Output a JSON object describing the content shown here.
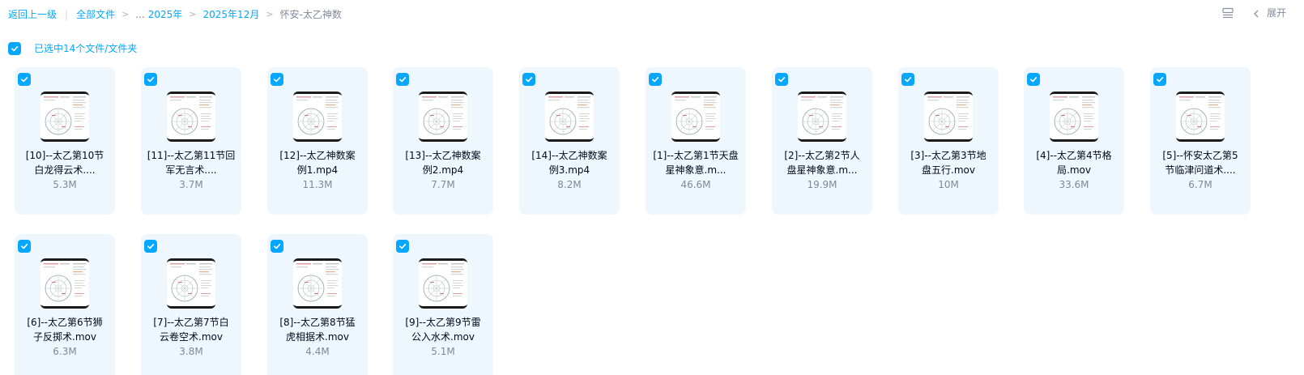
{
  "breadcrumb": {
    "back": "返回上一级",
    "all_files": "全部文件",
    "ellipsis": "...",
    "year": "2025年",
    "month": "2025年12月",
    "current": "怀安-太乙神数",
    "separator": "|",
    "arrow": ">"
  },
  "toolbar": {
    "list_view_icon": "list-view-icon",
    "collapse_icon": "chevron-left-icon",
    "expand_label": "展开"
  },
  "selection": {
    "label": "已选中14个文件/文件夹",
    "checked": true
  },
  "colors": {
    "accent": "#06a7ff",
    "card_bg": "#eef7fe",
    "text_primary": "#03081a",
    "text_secondary": "#818999"
  },
  "files": [
    {
      "line1": "[10]--太乙第10节",
      "line2": "白龙得云术....",
      "size": "5.3M",
      "checked": true
    },
    {
      "line1": "[11]--太乙第11节回",
      "line2": "军无言术....",
      "size": "3.7M",
      "checked": true
    },
    {
      "line1": "[12]--太乙神数案",
      "line2": "例1.mp4",
      "size": "11.3M",
      "checked": true
    },
    {
      "line1": "[13]--太乙神数案",
      "line2": "例2.mp4",
      "size": "7.7M",
      "checked": true
    },
    {
      "line1": "[14]--太乙神数案",
      "line2": "例3.mp4",
      "size": "8.2M",
      "checked": true
    },
    {
      "line1": "[1]--太乙第1节天盘",
      "line2": "星神象意.m...",
      "size": "46.6M",
      "checked": true
    },
    {
      "line1": "[2]--太乙第2节人",
      "line2": "盘星神象意.m...",
      "size": "19.9M",
      "checked": true
    },
    {
      "line1": "[3]--太乙第3节地",
      "line2": "盘五行.mov",
      "size": "10M",
      "checked": true
    },
    {
      "line1": "[4]--太乙第4节格",
      "line2": "局.mov",
      "size": "33.6M",
      "checked": true
    },
    {
      "line1": "[5]--怀安太乙第5",
      "line2": "节临津问道术....",
      "size": "6.7M",
      "checked": true
    },
    {
      "line1": "[6]--太乙第6节狮",
      "line2": "子反掷术.mov",
      "size": "6.3M",
      "checked": true
    },
    {
      "line1": "[7]--太乙第7节白",
      "line2": "云卷空术.mov",
      "size": "3.8M",
      "checked": true
    },
    {
      "line1": "[8]--太乙第8节猛",
      "line2": "虎相据术.mov",
      "size": "4.4M",
      "checked": true
    },
    {
      "line1": "[9]--太乙第9节雷",
      "line2": "公入水术.mov",
      "size": "5.1M",
      "checked": true
    }
  ]
}
